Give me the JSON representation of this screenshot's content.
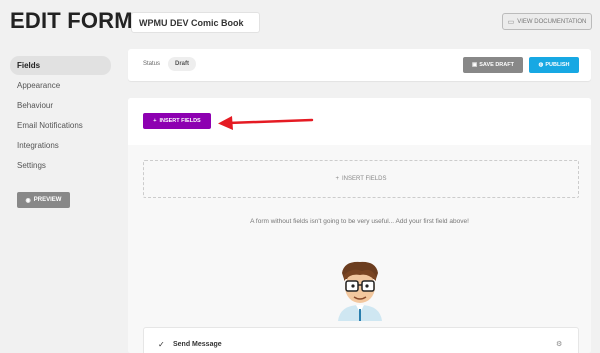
{
  "header": {
    "title": "EDIT FORM",
    "form_name": "WPMU DEV Comic Book",
    "doc_label": "VIEW DOCUMENTATION"
  },
  "sidebar": {
    "items": [
      {
        "label": "Fields"
      },
      {
        "label": "Appearance"
      },
      {
        "label": "Behaviour"
      },
      {
        "label": "Email Notifications"
      },
      {
        "label": "Integrations"
      },
      {
        "label": "Settings"
      }
    ],
    "active_index": 0,
    "preview_label": "PREVIEW"
  },
  "status": {
    "label": "Status",
    "value": "Draft",
    "save_draft_label": "SAVE DRAFT",
    "publish_label": "PUBLISH"
  },
  "builder": {
    "insert_button_label": "INSERT FIELDS",
    "dropzone_label": "INSERT FIELDS",
    "empty_message": "A form without fields isn't going to be very useful... Add your first field above!",
    "send_message_label": "Send Message"
  },
  "colors": {
    "accent_purple": "#8d00b1",
    "publish_blue": "#17a8e3",
    "arrow_red": "#e51b23",
    "button_grey": "#888888"
  }
}
